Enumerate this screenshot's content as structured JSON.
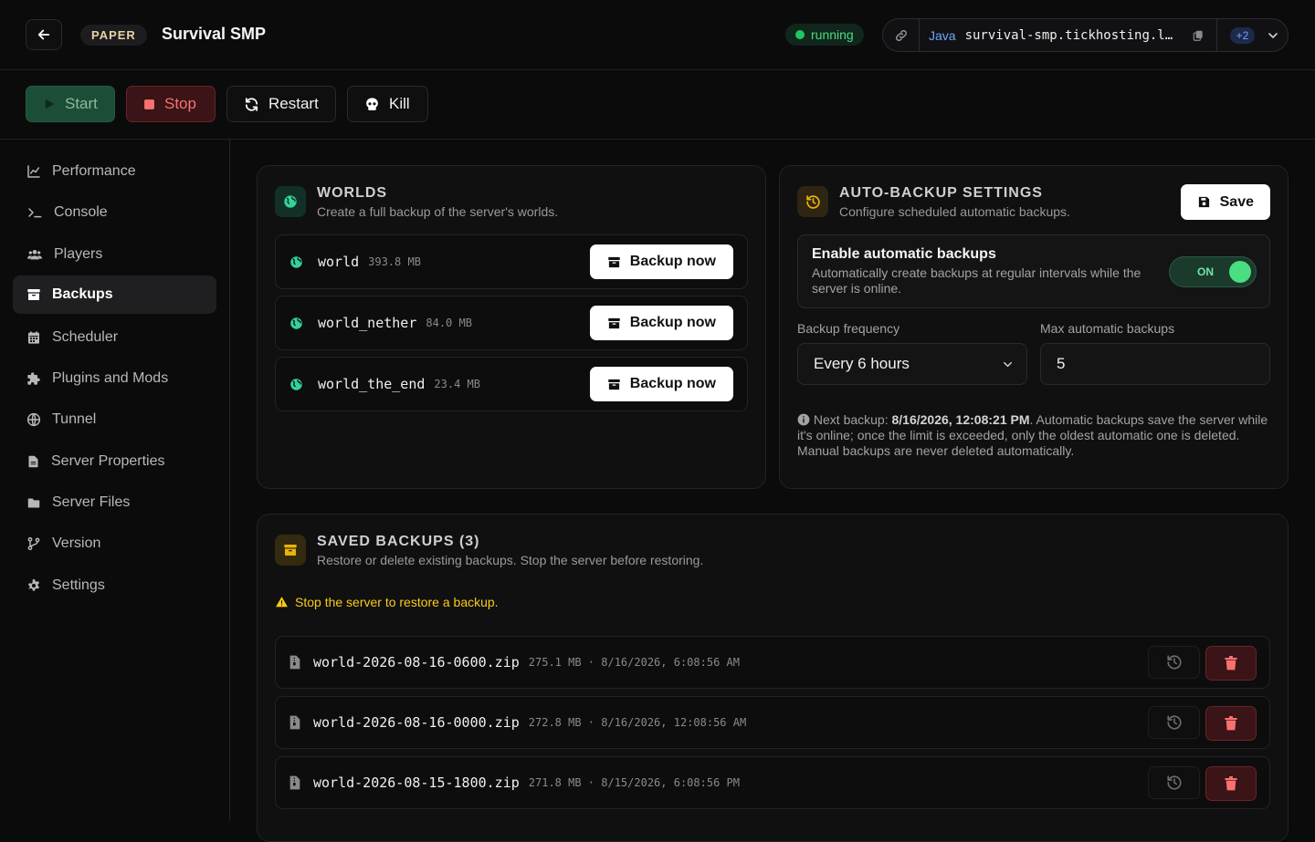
{
  "header": {
    "server_type": "PAPER",
    "title": "Survival SMP",
    "status": "running",
    "edition": "Java",
    "address": "survival-smp.tickhosting.l…",
    "extra_addresses": "+2"
  },
  "toolbar": {
    "start": "Start",
    "stop": "Stop",
    "restart": "Restart",
    "kill": "Kill"
  },
  "sidebar": {
    "items": [
      {
        "label": "Performance"
      },
      {
        "label": "Console"
      },
      {
        "label": "Players"
      },
      {
        "label": "Backups"
      },
      {
        "label": "Scheduler"
      },
      {
        "label": "Plugins and Mods"
      },
      {
        "label": "Tunnel"
      },
      {
        "label": "Server Properties"
      },
      {
        "label": "Server Files"
      },
      {
        "label": "Version"
      },
      {
        "label": "Settings"
      }
    ],
    "active": "Backups"
  },
  "worlds": {
    "title": "WORLDS",
    "subtitle": "Create a full backup of the server's worlds.",
    "button_label": "Backup now",
    "items": [
      {
        "name": "world",
        "size": "393.8 MB"
      },
      {
        "name": "world_nether",
        "size": "84.0 MB"
      },
      {
        "name": "world_the_end",
        "size": "23.4 MB"
      }
    ]
  },
  "auto_backup": {
    "title": "AUTO-BACKUP SETTINGS",
    "subtitle": "Configure scheduled automatic backups.",
    "save_label": "Save",
    "enable_title": "Enable automatic backups",
    "enable_desc": "Automatically create backups at regular intervals while the server is online.",
    "toggle_label": "ON",
    "toggle_on": true,
    "frequency_label": "Backup frequency",
    "frequency_value": "Every 6 hours",
    "max_label": "Max automatic backups",
    "max_value": "5",
    "info_prefix": "Next backup: ",
    "info_date": "8/16/2026, 12:08:21 PM",
    "info_suffix": ". Automatic backups save the server while it's online; once the limit is exceeded, only the oldest automatic one is deleted. Manual backups are never deleted automatically."
  },
  "saved_backups": {
    "title": "SAVED BACKUPS (3)",
    "subtitle": "Restore or delete existing backups. Stop the server before restoring.",
    "warning": "Stop the server to restore a backup.",
    "items": [
      {
        "name": "world-2026-08-16-0600.zip",
        "meta": "275.1 MB · 8/16/2026, 6:08:56 AM"
      },
      {
        "name": "world-2026-08-16-0000.zip",
        "meta": "272.8 MB · 8/16/2026, 12:08:56 AM"
      },
      {
        "name": "world-2026-08-15-1800.zip",
        "meta": "271.8 MB · 8/15/2026, 6:08:56 PM"
      }
    ]
  },
  "colors": {
    "accent_green": "#22c55e",
    "danger_red": "#f87171",
    "warning_yellow": "#facc15",
    "link_blue": "#6aa8ff"
  }
}
